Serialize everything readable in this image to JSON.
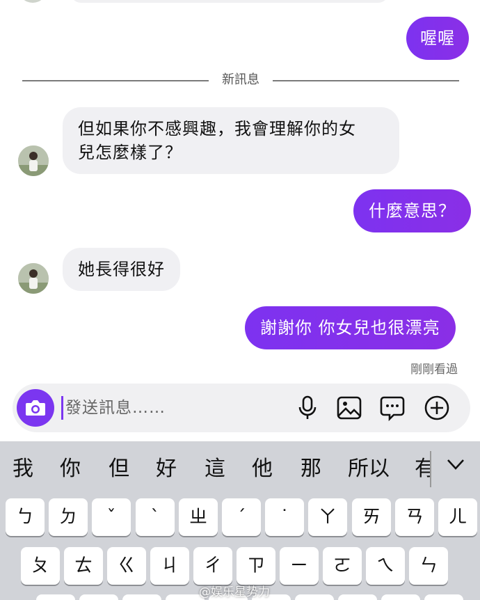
{
  "divider_label": "新訊息",
  "messages": {
    "top_out": "喔喔",
    "in_1_line1": "但如果你不感興趣，我會理解你的女",
    "in_1_line2": "兒怎麼樣了？",
    "out_2": "什麼意思？",
    "in_2": "她長得很好",
    "out_3": "謝謝你 你女兒也很漂亮"
  },
  "seen_status": "剛剛看過",
  "composer": {
    "placeholder": "發送訊息……",
    "icons": [
      "camera-icon",
      "microphone-icon",
      "image-icon",
      "sticker-icon",
      "add-icon"
    ]
  },
  "keyboard": {
    "candidates": [
      "我",
      "你",
      "但",
      "好",
      "這",
      "他",
      "那",
      "所以",
      "有"
    ],
    "row1": [
      "ㄅ",
      "ㄉ",
      "ˇ",
      "ˋ",
      "ㄓ",
      "ˊ",
      "˙",
      "ㄚ",
      "ㄞ",
      "ㄢ",
      "ㄦ"
    ],
    "row2": [
      "ㄆ",
      "ㄊ",
      "ㄍ",
      "ㄐ",
      "ㄔ",
      "ㄗ",
      "ㄧ",
      "ㄛ",
      "ㄟ",
      "ㄣ"
    ]
  },
  "watermark": "@娱乐星势力",
  "colors": {
    "accent": "#7b36f0",
    "incoming_bubble": "#f0f0f3",
    "keyboard_bg": "#d1d3d8"
  }
}
